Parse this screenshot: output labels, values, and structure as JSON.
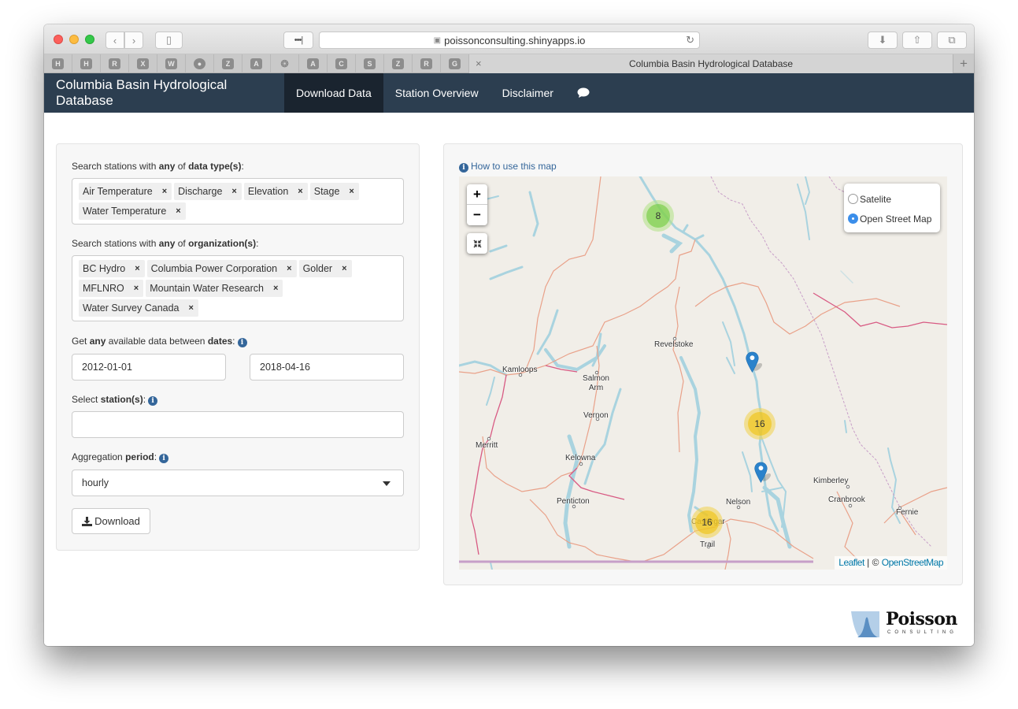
{
  "browser": {
    "url": "poissonconsulting.shinyapps.io",
    "tab_title": "Columbia Basin Hydrological Database",
    "favorites": [
      "H",
      "H",
      "R",
      "X",
      "W",
      "github",
      "Z",
      "A",
      "badge",
      "A",
      "C",
      "S",
      "Z",
      "R",
      "G"
    ],
    "icons": {
      "back": "‹",
      "forward": "›",
      "sidebar": "▯",
      "dots": "•••|",
      "lock": "🔒",
      "reload": "↻",
      "download": "⬇",
      "share": "⇧",
      "tabs": "⧉",
      "close": "×",
      "new_tab": "+"
    }
  },
  "navbar": {
    "brand": "Columbia Basin Hydrological Database",
    "items": [
      {
        "label": "Download Data",
        "active": true
      },
      {
        "label": "Station Overview",
        "active": false
      },
      {
        "label": "Disclaimer",
        "active": false
      }
    ],
    "chat_icon": "💬"
  },
  "form": {
    "data_types": {
      "label_prefix": "Search stations with ",
      "label_any": "any",
      "label_of": " of ",
      "label_strong": "data type(s)",
      "label_suffix": ":",
      "selected": [
        "Air Temperature",
        "Discharge",
        "Elevation",
        "Stage",
        "Water Temperature"
      ]
    },
    "organizations": {
      "label_prefix": "Search stations with ",
      "label_any": "any",
      "label_of": " of ",
      "label_strong": "organization(s)",
      "label_suffix": ":",
      "selected": [
        "BC Hydro",
        "Columbia Power Corporation",
        "Golder",
        "MFLNRO",
        "Mountain Water Research",
        "Water Survey Canada"
      ]
    },
    "dates": {
      "label_prefix": "Get ",
      "label_any": "any",
      "label_mid": " available data between ",
      "label_strong": "dates",
      "label_suffix": ":",
      "start": "2012-01-01",
      "end": "2018-04-16"
    },
    "stations": {
      "label_prefix": "Select ",
      "label_strong": "station(s)",
      "label_suffix": ":",
      "value": ""
    },
    "aggregation": {
      "label_prefix": "Aggregation ",
      "label_strong": "period",
      "label_suffix": ":",
      "value": "hourly"
    },
    "remove_glyph": "×",
    "info_glyph": "i",
    "download_label": "Download",
    "download_icon": "⤓"
  },
  "map": {
    "help_link": "How to use this map",
    "zoom_in": "+",
    "zoom_out": "−",
    "reset_icon": "⌗",
    "layers": [
      {
        "label": "Satelite",
        "selected": false
      },
      {
        "label": "Open Street Map",
        "selected": true
      }
    ],
    "clusters": [
      {
        "count": "8",
        "color": "green"
      },
      {
        "count": "16",
        "color": "yellow"
      },
      {
        "count": "16",
        "color": "yellow"
      }
    ],
    "markers": 2,
    "cities": [
      "Revelstoke",
      "Kamloops",
      "Salmon Arm",
      "Vernon",
      "Merritt",
      "Kelowna",
      "Penticton",
      "Nelson",
      "Castlegar",
      "Trail",
      "Kimberley",
      "Cranbrook",
      "Fernie"
    ],
    "attribution": {
      "leaflet": "Leaflet",
      "separator": " | © ",
      "osm": "OpenStreetMap"
    }
  },
  "footer": {
    "logo_name": "Poisson",
    "logo_sub": "CONSULTING"
  },
  "colors": {
    "navbar": "#2c3e50",
    "navbar_active": "#1a242f",
    "link": "#34669a",
    "cluster_green": "#8fd16f",
    "cluster_yellow": "#f0c93f",
    "marker_blue": "#2b82cb"
  }
}
